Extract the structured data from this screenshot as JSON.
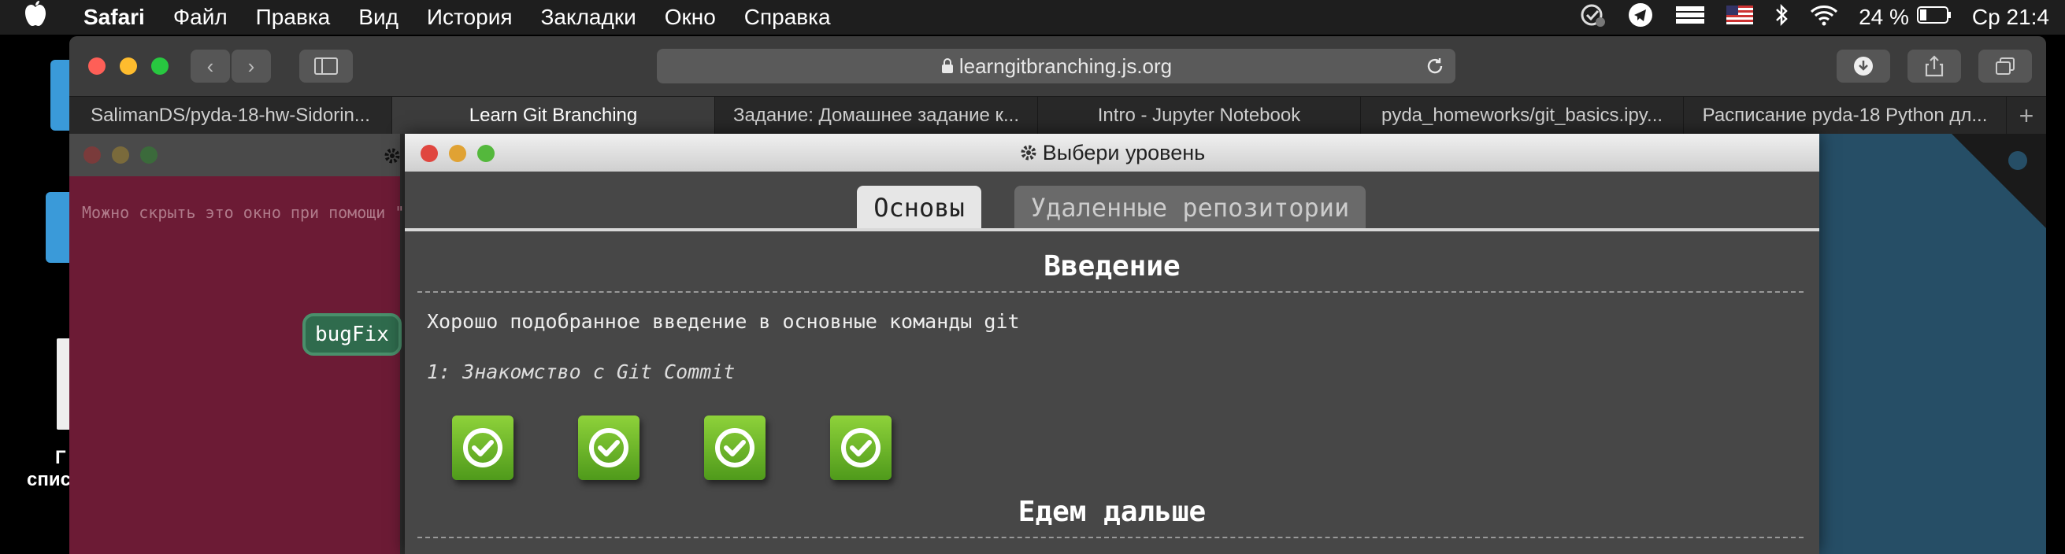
{
  "menubar": {
    "app_name": "Safari",
    "items": [
      "Файл",
      "Правка",
      "Вид",
      "История",
      "Закладки",
      "Окно",
      "Справка"
    ],
    "battery": "24 %",
    "clock": "Ср 21:4"
  },
  "desktop": {
    "label_fragment_1": "Г",
    "label_fragment_2": "спис"
  },
  "safari": {
    "url": "learngitbranching.js.org",
    "tabs": [
      {
        "label": "SalimanDS/pyda-18-hw-Sidorin..."
      },
      {
        "label": "Learn Git Branching"
      },
      {
        "label": "Задание: Домашнее задание к..."
      },
      {
        "label": "Intro - Jupyter Notebook"
      },
      {
        "label": "pyda_homeworks/git_basics.ipy..."
      },
      {
        "label": "Расписание pyda-18 Python дл..."
      }
    ]
  },
  "page": {
    "left_hint": "Можно скрыть это окно при помощи \"",
    "branch_label": "bugFix",
    "modal": {
      "title": "Выбери уровень",
      "level_tabs": [
        "Основы",
        "Удаленные репозитории"
      ],
      "section1_title": "Введение",
      "section1_desc": "Хорошо подобранное введение в основные команды git",
      "section1_lesson": "1: Знакомство с Git Commit",
      "levels_completed": 4,
      "section2_title": "Едем дальше"
    }
  },
  "colors": {
    "menubar_bg": "#1e1e1e",
    "left_panel_bg": "#6c1b35",
    "right_panel_bg": "#264e66",
    "level_done": "#6cbf2a"
  }
}
